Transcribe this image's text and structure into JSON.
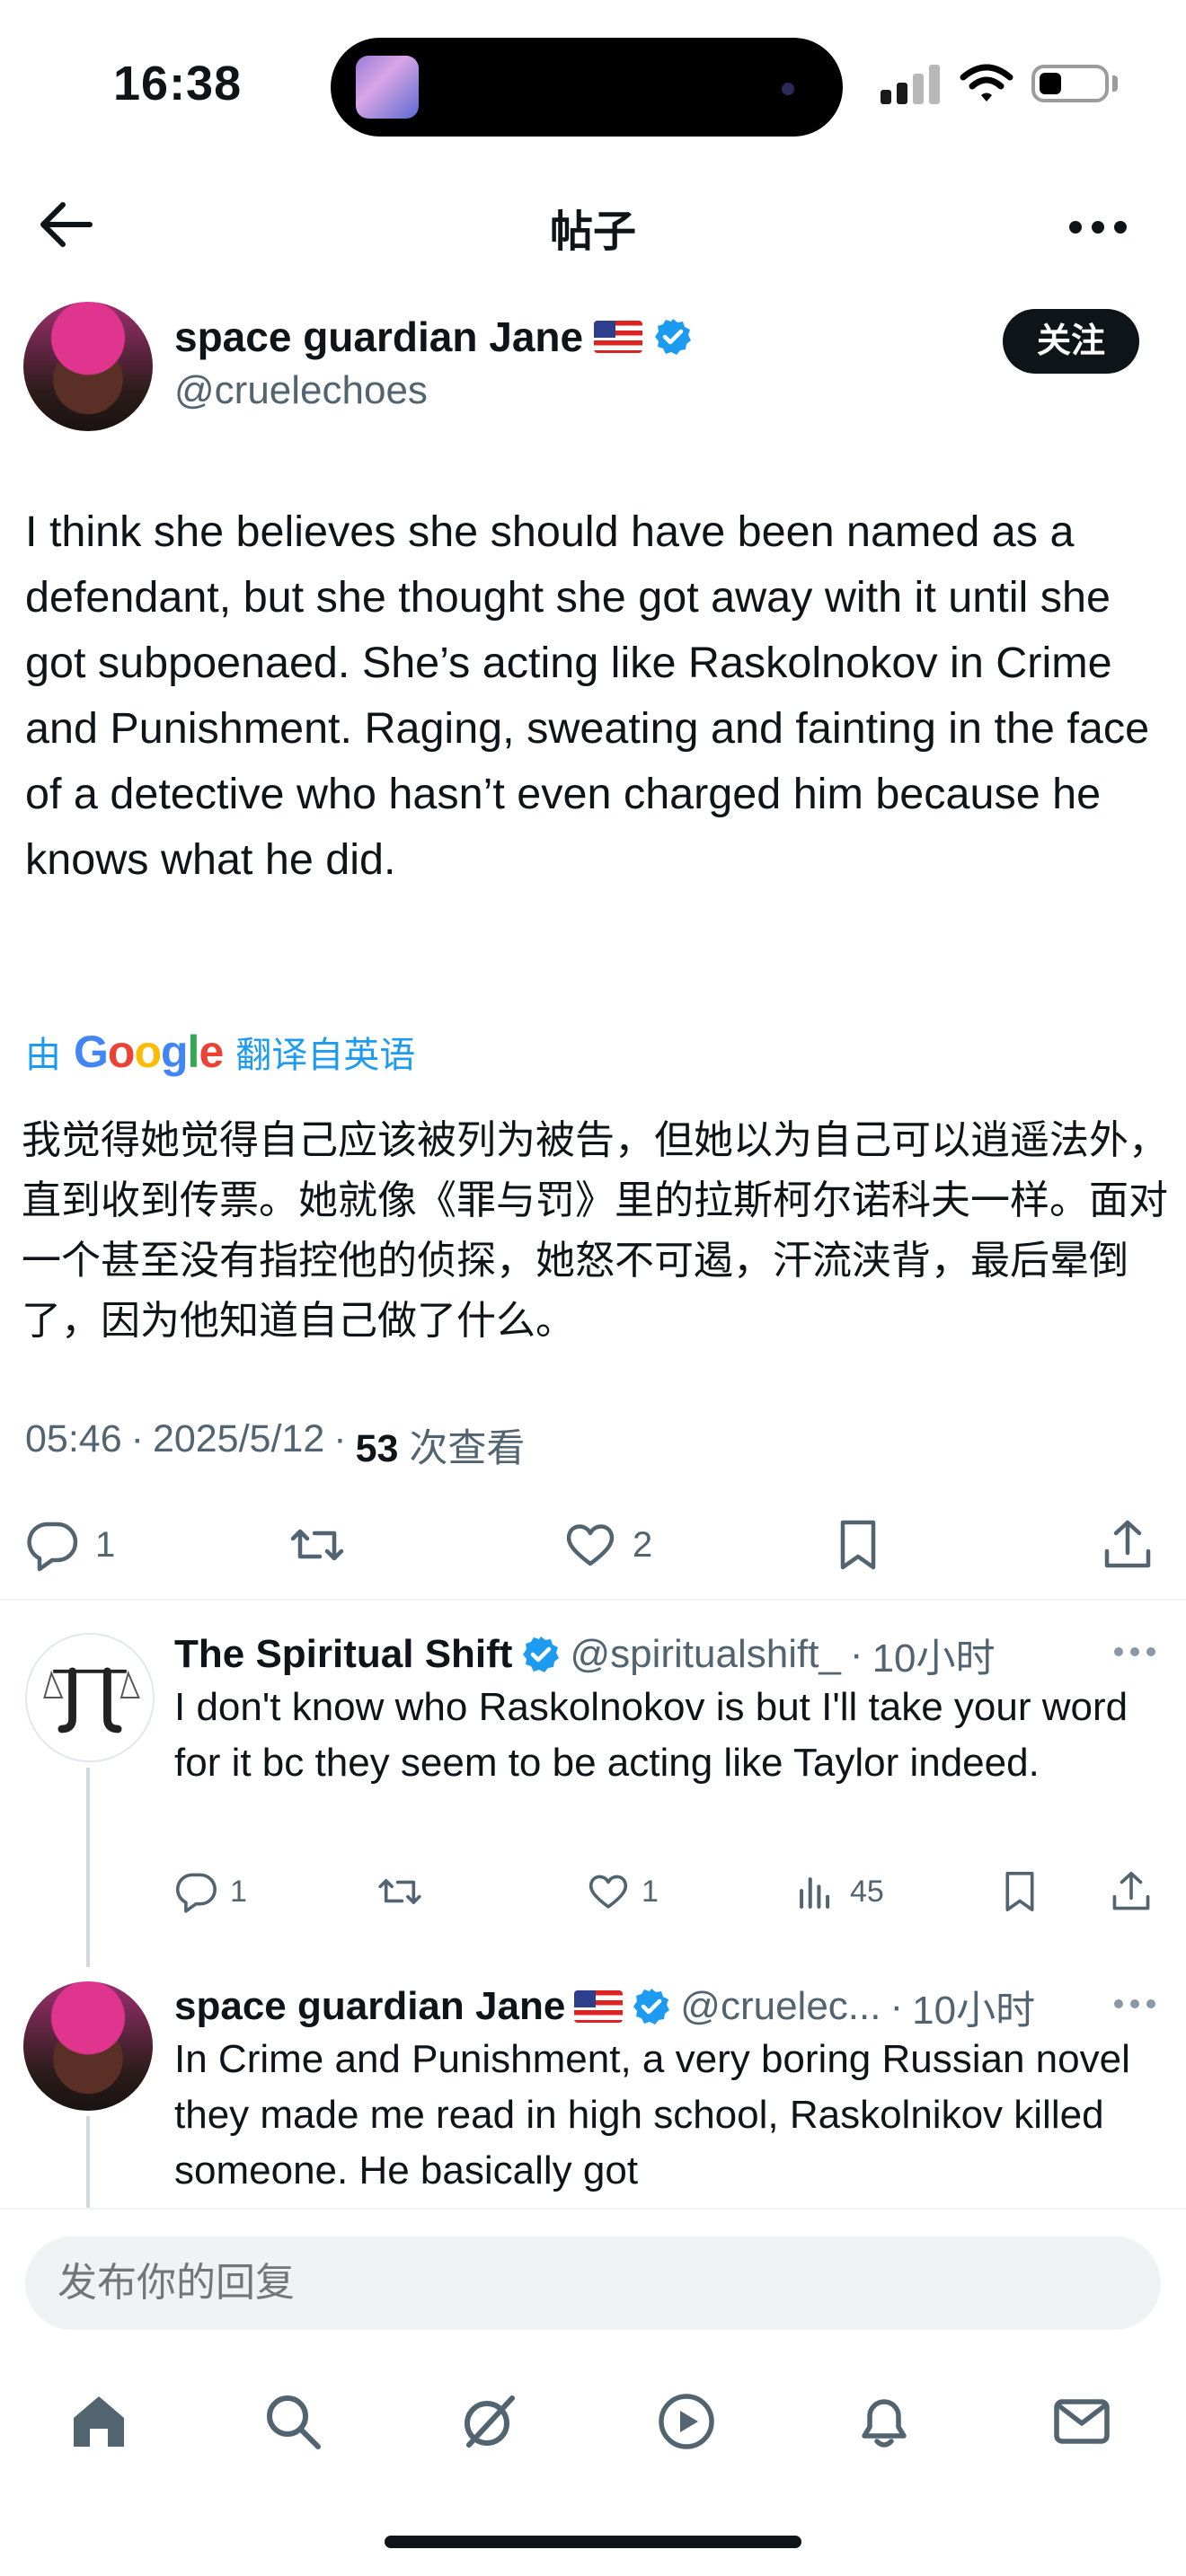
{
  "status": {
    "time": "16:38"
  },
  "header": {
    "title": "帖子"
  },
  "post": {
    "author_name": "space guardian Jane",
    "author_handle": "@cruelechoes",
    "follow_label": "关注",
    "text": "I think she believes she should have been named as a defendant, but she thought she got away with it until she got subpoenaed. She’s acting like Raskolnokov in Crime and Punishment. Raging, sweating and fainting in the face of a detective who hasn’t even charged him because he knows what he did.",
    "translate_prefix": "由",
    "translate_brand": "Google",
    "translate_suffix": "翻译自英语",
    "translated_text": "我觉得她觉得自己应该被列为被告，但她以为自己可以逍遥法外，直到收到传票。她就像《罪与罚》里的拉斯柯尔诺科夫一样。面对一个甚至没有指控他的侦探，她怒不可遏，汗流浃背，最后晕倒了，因为他知道自己做了什么。",
    "time": "05:46",
    "date": "2025/5/12",
    "views": "53",
    "views_label": "次查看",
    "replies": "1",
    "likes": "2"
  },
  "replies": [
    {
      "name": "The Spiritual Shift",
      "handle": "@spiritualshift_",
      "age": "10小时",
      "text": "I don't know who Raskolnokov is but I'll take your word for it bc they seem to be acting like Taylor indeed.",
      "reply_count": "1",
      "like_count": "1",
      "view_count": "45"
    },
    {
      "name": "space guardian Jane",
      "handle": "@cruelec...",
      "age": "10小时",
      "text": "In Crime and Punishment, a very boring Russian novel they made me read in high school, Raskolnikov killed someone. He basically got"
    }
  ],
  "composer": {
    "placeholder": "发布你的回复"
  },
  "colors": {
    "accent": "#1d9bf0",
    "text": "#0f1419",
    "muted": "#536471",
    "google_blue": "#4285f4",
    "google_red": "#ea4335",
    "google_yellow": "#fbbc05",
    "google_green": "#34a853"
  },
  "icons": [
    "back-arrow-icon",
    "more-icon",
    "verified-icon",
    "us-flag-icon",
    "reply-icon",
    "retweet-icon",
    "like-icon",
    "bookmark-icon",
    "share-icon",
    "analytics-icon",
    "home-icon",
    "search-icon",
    "grok-icon",
    "video-icon",
    "notifications-icon",
    "messages-icon"
  ]
}
